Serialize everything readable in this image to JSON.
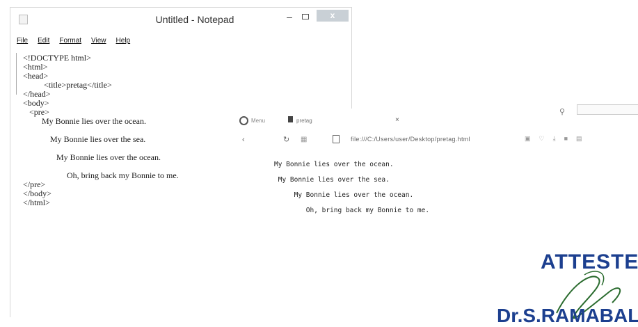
{
  "notepad": {
    "title": "Untitled - Notepad",
    "close_label": "x",
    "menu": [
      "File",
      "Edit",
      "Format",
      "View",
      "Help"
    ],
    "code": "<!DOCTYPE html>\n<html>\n<head>\n          <title>pretag</title>\n</head>\n<body>\n   <pre>\n         My Bonnie lies over the ocean.\n\n             My Bonnie lies over the sea.\n\n                My Bonnie lies over the ocean.\n\n                     Oh, bring back my Bonnie to me.\n</pre>\n</body>\n</html>"
  },
  "browser": {
    "tab_menu": "Menu",
    "tab_title": "pretag",
    "tab_close": "×",
    "url": "file:///C:/Users/user/Desktop/pretag.html",
    "content": "My Bonnie lies over the ocean.\n My Bonnie lies over the sea.\n     My Bonnie lies over the ocean.\n        Oh, bring back my Bonnie to me."
  },
  "stamp": {
    "attested": "ATTESTED",
    "signer": "Dr.S.RAMABALA"
  },
  "colors": {
    "stamp_blue": "#1c3f8f",
    "close_button": "#c9d0d6"
  }
}
